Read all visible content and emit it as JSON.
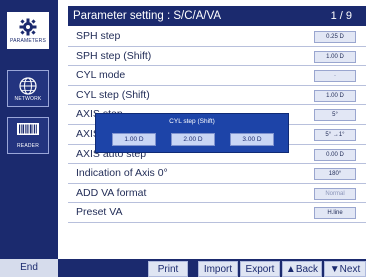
{
  "sidebar": {
    "items": [
      {
        "label": "PARAMETERS",
        "icon": "gear-icon"
      },
      {
        "label": "NETWORK",
        "icon": "globe-icon"
      },
      {
        "label": "READER",
        "icon": "barcode-icon"
      }
    ]
  },
  "header": {
    "title": "Parameter setting : S/C/A/VA",
    "page": "1 / 9"
  },
  "rows": [
    {
      "label": "SPH step",
      "value": "0.25 D"
    },
    {
      "label": "SPH step (Shift)",
      "value": "1.00 D"
    },
    {
      "label": "CYL mode",
      "value": "-"
    },
    {
      "label": "CYL step (Shift)",
      "value": "1.00 D"
    },
    {
      "label": "AXIS step",
      "value": "5°"
    },
    {
      "label": "AXIS step (Shift)",
      "value": "5° →1°"
    },
    {
      "label": "AXIS auto step",
      "value": "0.00 D"
    },
    {
      "label": "Indication of Axis 0°",
      "value": "180°"
    },
    {
      "label": "ADD VA format",
      "value": "Normal"
    },
    {
      "label": "Preset VA",
      "value": "H.line"
    }
  ],
  "popup": {
    "title": "CYL step (Shift)",
    "options": [
      "1.00 D",
      "2.00 D",
      "3.00 D"
    ]
  },
  "footer": {
    "end": "End",
    "print": "Print",
    "import": "Import",
    "export": "Export",
    "back": "▲Back",
    "next": "▼Next"
  },
  "colors": {
    "navy": "#1b2a6e",
    "popup": "#1d44a8",
    "value_box": "#e2e7f5"
  }
}
